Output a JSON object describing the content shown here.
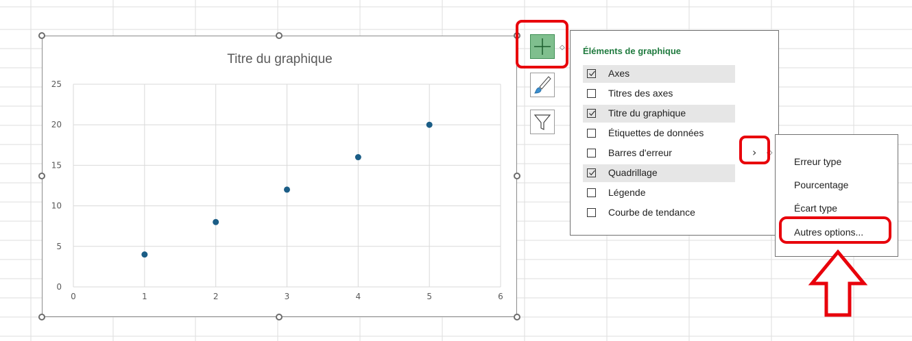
{
  "chart": {
    "title": "Titre du graphique"
  },
  "chart_data": {
    "type": "scatter",
    "title": "Titre du graphique",
    "x": [
      1,
      2,
      3,
      4,
      5
    ],
    "y": [
      4,
      8,
      12,
      16,
      20
    ],
    "xlim": [
      0,
      6
    ],
    "ylim": [
      0,
      25
    ],
    "x_ticks": [
      0,
      1,
      2,
      3,
      4,
      5,
      6
    ],
    "y_ticks": [
      0,
      5,
      10,
      15,
      20,
      25
    ],
    "grid": true,
    "marker_color": "#1b5d86"
  },
  "elements_pane": {
    "title": "Éléments de graphique",
    "options": [
      {
        "label": "Axes",
        "checked": true
      },
      {
        "label": "Titres des axes",
        "checked": false
      },
      {
        "label": "Titre du graphique",
        "checked": true
      },
      {
        "label": "Étiquettes de données",
        "checked": false
      },
      {
        "label": "Barres d'erreur",
        "checked": false
      },
      {
        "label": "Quadrillage",
        "checked": true
      },
      {
        "label": "Légende",
        "checked": false
      },
      {
        "label": "Courbe de tendance",
        "checked": false
      }
    ]
  },
  "submenu": {
    "items": [
      "Erreur type",
      "Pourcentage",
      "Écart type",
      "Autres options..."
    ]
  },
  "colors": {
    "highlight": "#e8000b",
    "accent_green": "#1f7a3e",
    "plus_button": "#7fbf8e"
  },
  "icons": {
    "elements": "plus-icon",
    "styles": "brush-icon",
    "filters": "funnel-icon"
  }
}
